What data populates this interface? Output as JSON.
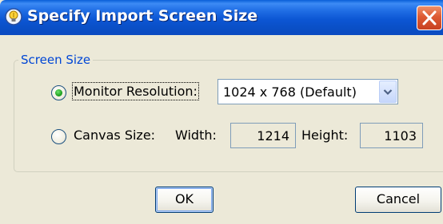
{
  "window": {
    "title": "Specify Import Screen Size",
    "icon": "app-lightbulb-icon",
    "close_icon": "close-icon"
  },
  "group": {
    "legend": "Screen Size"
  },
  "options": {
    "monitor": {
      "label": "Monitor Resolution:",
      "selected": true,
      "resolution": "1024 x 768 (Default)"
    },
    "canvas": {
      "label": "Canvas Size:",
      "selected": false,
      "width_label": "Width:",
      "width_value": "1214",
      "height_label": "Height:",
      "height_value": "1103"
    }
  },
  "buttons": {
    "ok": "OK",
    "cancel": "Cancel"
  },
  "colors": {
    "titlebar": "#0a4fc6",
    "close": "#d9532f",
    "legend": "#0046d5",
    "radio_selected": "#21a121",
    "face": "#ece9d8"
  }
}
